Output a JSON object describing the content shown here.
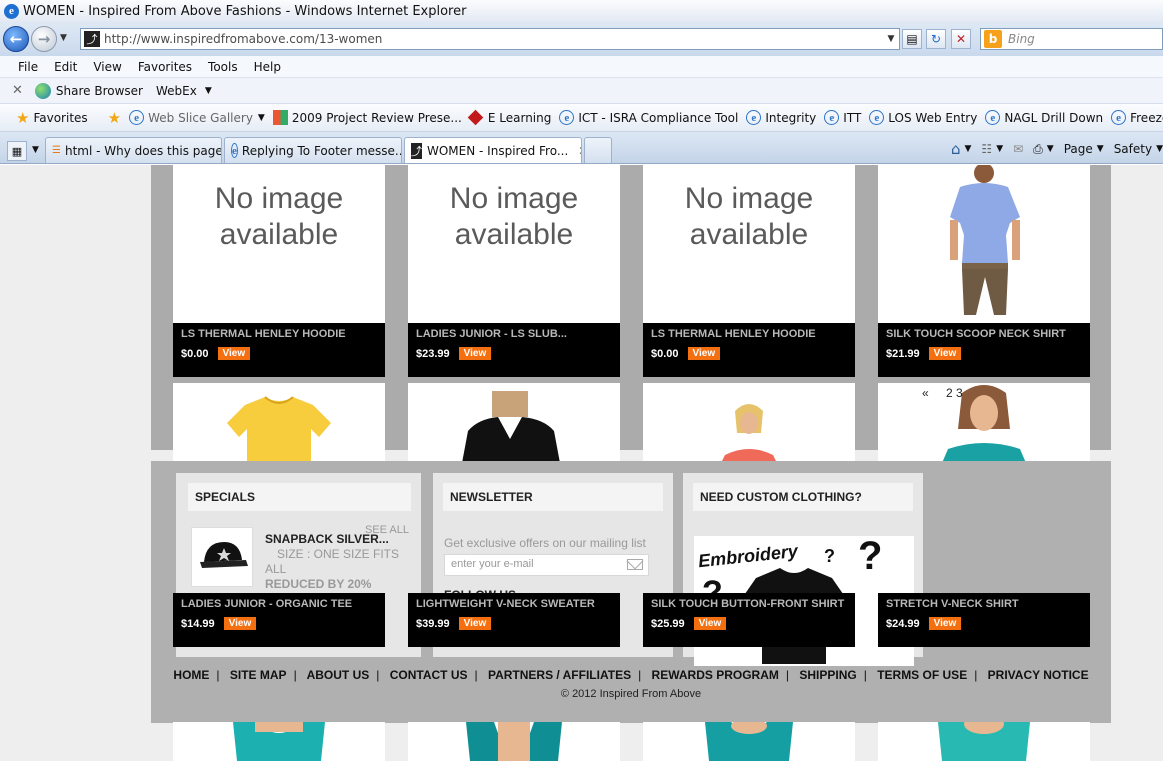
{
  "window": {
    "title": "WOMEN - Inspired From Above Fashions - Windows Internet Explorer"
  },
  "address": {
    "url": "http://www.inspiredfromabove.com/13-women",
    "search_placeholder": "Bing"
  },
  "menu": [
    "File",
    "Edit",
    "View",
    "Favorites",
    "Tools",
    "Help"
  ],
  "webex": {
    "share": "Share Browser",
    "webex": "WebEx"
  },
  "favorites": {
    "label": "Favorites",
    "links": [
      "Web Slice Gallery",
      "2009 Project Review Prese...",
      "E Learning",
      "ICT - ISRA Compliance Tool",
      "Integrity",
      "ITT",
      "LOS Web Entry",
      "NAGL Drill Down",
      "Freeze Exception R"
    ]
  },
  "tabs": [
    "html - Why does this page...",
    "Replying To Footer messe...",
    "WOMEN - Inspired Fro..."
  ],
  "commands": {
    "page": "Page",
    "safety": "Safety"
  },
  "no_image": "No image available",
  "view_label": "View",
  "products": [
    {
      "name": "LS THERMAL HENLEY HOODIE",
      "price": "$0.00"
    },
    {
      "name": "LADIES JUNIOR - LS SLUB...",
      "price": "$23.99"
    },
    {
      "name": "LS THERMAL HENLEY HOODIE",
      "price": "$0.00"
    },
    {
      "name": "SILK TOUCH SCOOP NECK SHIRT",
      "price": "$21.99"
    },
    {
      "name": "LADIES JUNIOR - ORGANIC TEE",
      "price": "$14.99"
    },
    {
      "name": "LIGHTWEIGHT V-NECK SWEATER",
      "price": "$39.99"
    },
    {
      "name": "SILK TOUCH BUTTON-FRONT SHIRT",
      "price": "$25.99"
    },
    {
      "name": "STRETCH V-NECK SHIRT",
      "price": "$24.99"
    }
  ],
  "pagination": {
    "prev": "«",
    "pages": "2 3"
  },
  "specials": {
    "title": "SPECIALS",
    "see_all": "SEE ALL",
    "product_name": "SNAPBACK SILVER...",
    "size": "SIZE : ONE SIZE FITS ALL",
    "reduced": "REDUCED BY 20%"
  },
  "newsletter": {
    "title": "NEWSLETTER",
    "text": "Get exclusive offers on our mailing list",
    "placeholder": "enter your e-mail",
    "follow": "FOLLOW US"
  },
  "custom": {
    "title": "NEED CUSTOM CLOTHING?",
    "image_text": "Embroidery"
  },
  "footer_links": [
    "HOME",
    "SITE MAP",
    "ABOUT US",
    "CONTACT US",
    "PARTNERS / AFFILIATES",
    "REWARDS PROGRAM",
    "SHIPPING",
    "TERMS OF USE",
    "PRIVACY NOTICE"
  ],
  "copyright": "© 2012 Inspired From Above",
  "colors": {
    "accent": "#f36f10",
    "caption_bg": "#000000",
    "content_bg": "#ababab"
  }
}
